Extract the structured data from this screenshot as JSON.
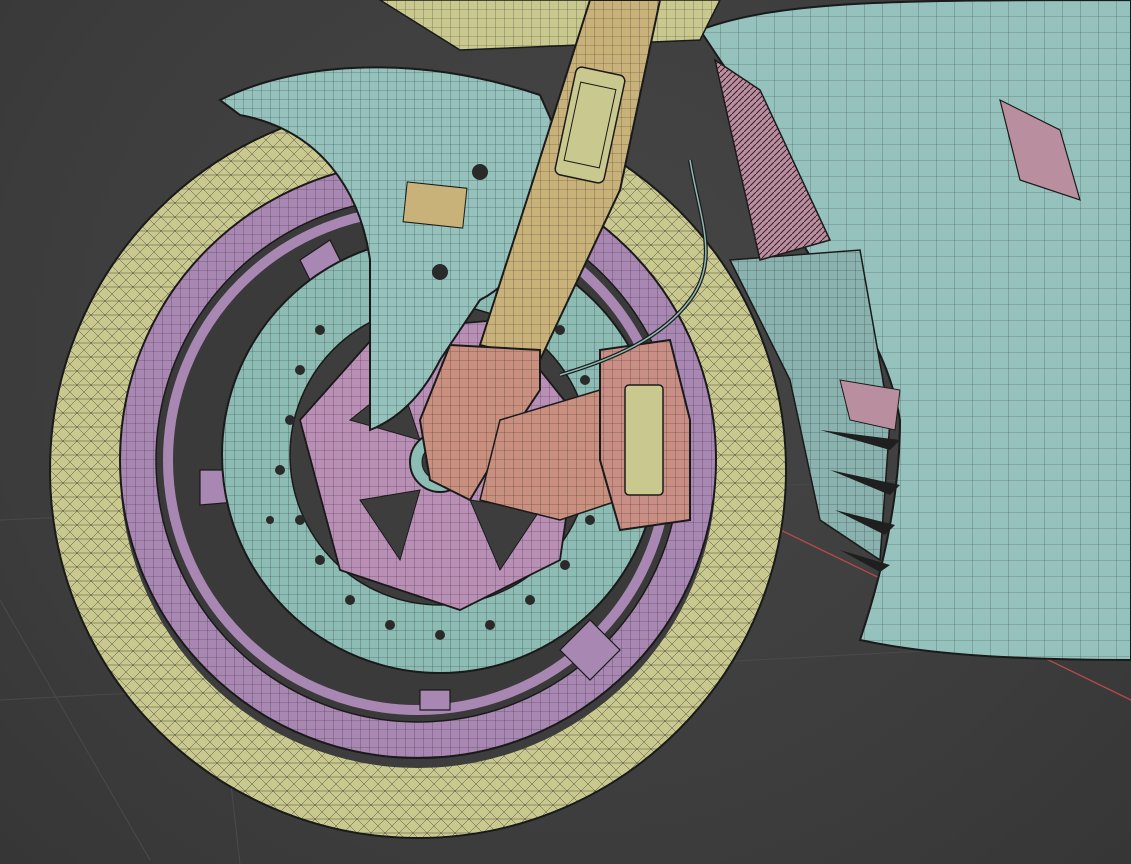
{
  "scene": {
    "palette": {
      "background": "#3d3d3d",
      "grid_line": "#4a4a4a",
      "axis_x": "#b84a4a",
      "tire": "#c9c98f",
      "rim": "#a987b3",
      "disc": "#8dbcb5",
      "hub": "#b98fb6",
      "fork_tube": "#c9b27a",
      "fork_lower": "#c98f7f",
      "caliper": "#c98f85",
      "fairing": "#95c2bd",
      "fender": "#95c2bd",
      "radiator": "#b98fa0",
      "wire": "#1c1c1c"
    },
    "objects": [
      "viewport-grid",
      "x-axis-line",
      "front-tire",
      "wheel-rim",
      "brake-disc",
      "wheel-hub",
      "front-fender",
      "fork-tube",
      "fork-lower",
      "brake-caliper",
      "side-fairing",
      "radiator",
      "brake-line"
    ]
  }
}
